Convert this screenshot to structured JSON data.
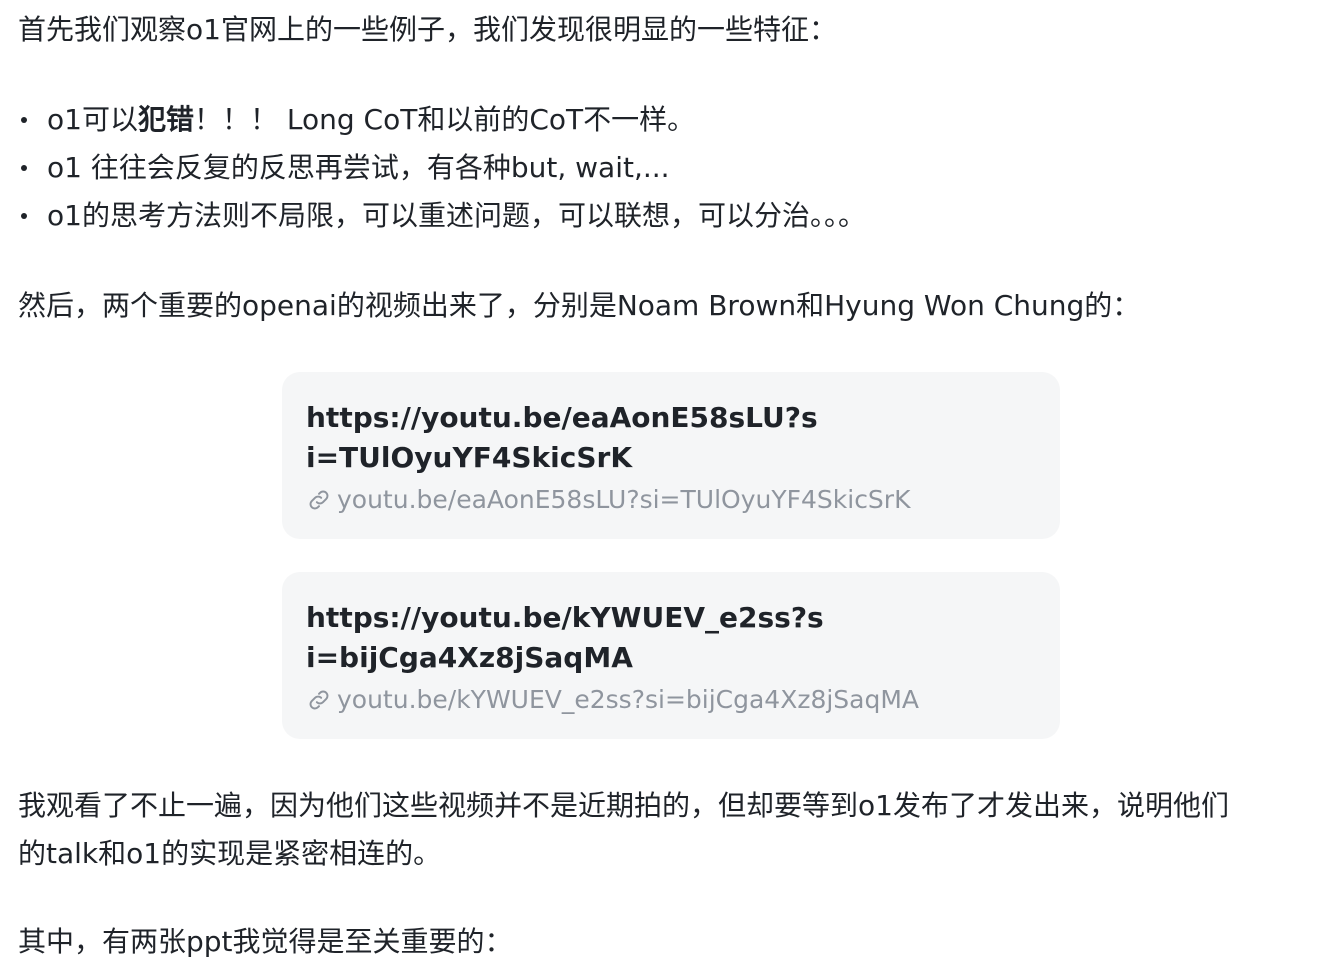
{
  "intro": "首先我们观察o1官网上的一些例子，我们发现很明显的一些特征：",
  "bullets": [
    {
      "pre": "o1可以",
      "bold": "犯错",
      "post": "！！！ Long CoT和以前的CoT不一样。"
    },
    {
      "text": "o1 往往会反复的反思再尝试，有各种but, wait,..."
    },
    {
      "text": "o1的思考方法则不局限，可以重述问题，可以联想，可以分治。。。"
    }
  ],
  "videos_intro": "然后，两个重要的openai的视频出来了，分别是Noam Brown和Hyung Won Chung的：",
  "link_cards": [
    {
      "title": "https://youtu.be/eaAonE58sLU?si=TUlOyuYF4SkicSrK",
      "url": "youtu.be/eaAonE58sLU?si=TUlOyuYF4SkicSrK",
      "icon": "link-icon"
    },
    {
      "title": "https://youtu.be/kYWUEV_e2ss?si=bijCga4Xz8jSaqMA",
      "url": "youtu.be/kYWUEV_e2ss?si=bijCga4Xz8jSaqMA",
      "icon": "link-icon"
    }
  ],
  "paragraph_line1": "我观看了不止一遍，因为他们这些视频并不是近期拍的，但却要等到o1发布了才发出来，说明他们",
  "paragraph_line2": "的talk和o1的实现是紧密相连的。",
  "ppt_intro": "其中，有两张ppt我觉得是至关重要的："
}
